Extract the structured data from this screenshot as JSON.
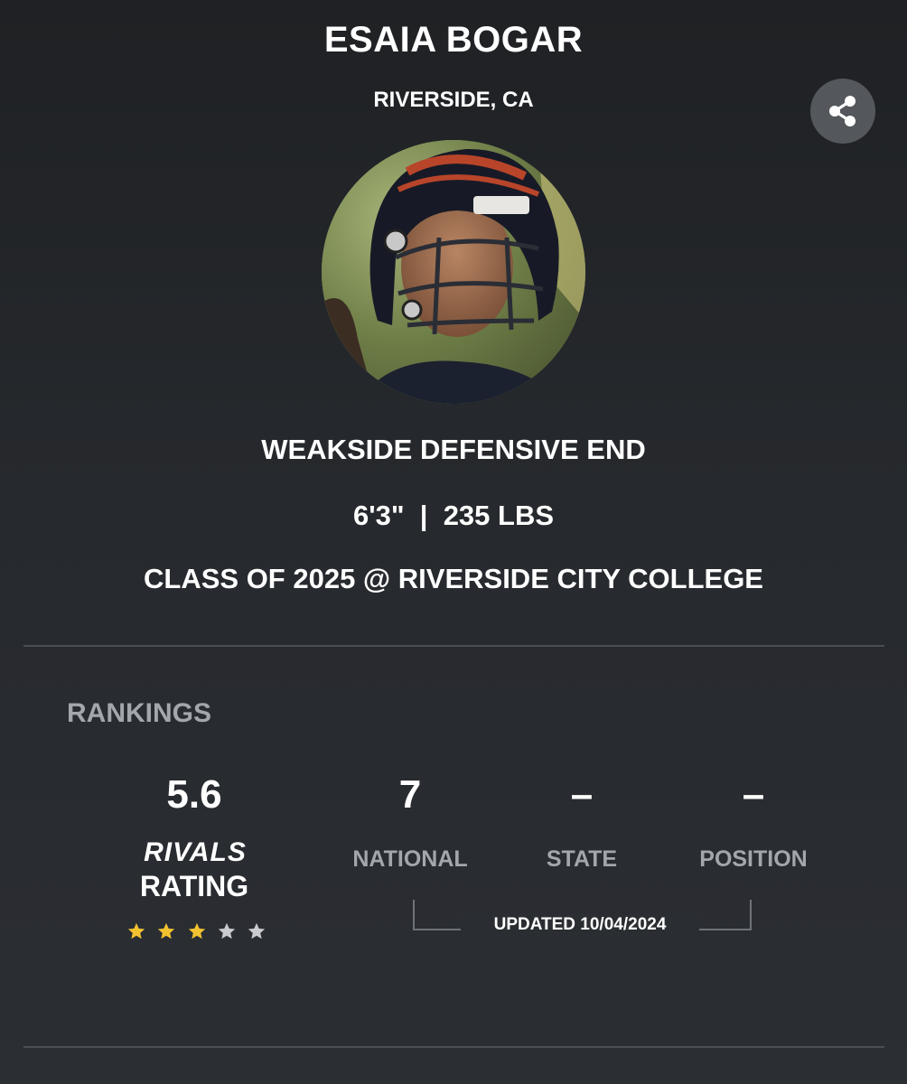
{
  "player": {
    "name": "ESAIA BOGAR",
    "hometown": "RIVERSIDE, CA",
    "position": "WEAKSIDE DEFENSIVE END",
    "height": "6'3\"",
    "separator": "|",
    "weight": "235 LBS",
    "class_line": "CLASS OF 2025 @ RIVERSIDE CITY COLLEGE"
  },
  "share": {
    "icon": "share-icon"
  },
  "rankings": {
    "heading": "RANKINGS",
    "rating": {
      "value": "5.6",
      "brand": "RIVALS",
      "label": "RATING",
      "stars_filled": 3,
      "stars_total": 5
    },
    "national": {
      "value": "7",
      "label": "NATIONAL"
    },
    "state": {
      "value": "–",
      "label": "STATE"
    },
    "position": {
      "value": "–",
      "label": "POSITION"
    },
    "updated": "UPDATED 10/04/2024"
  },
  "colors": {
    "star_filled": "#f2c230",
    "star_empty": "#c9cbce",
    "label_gray": "#a3a6ab",
    "share_bg": "#54575c"
  }
}
